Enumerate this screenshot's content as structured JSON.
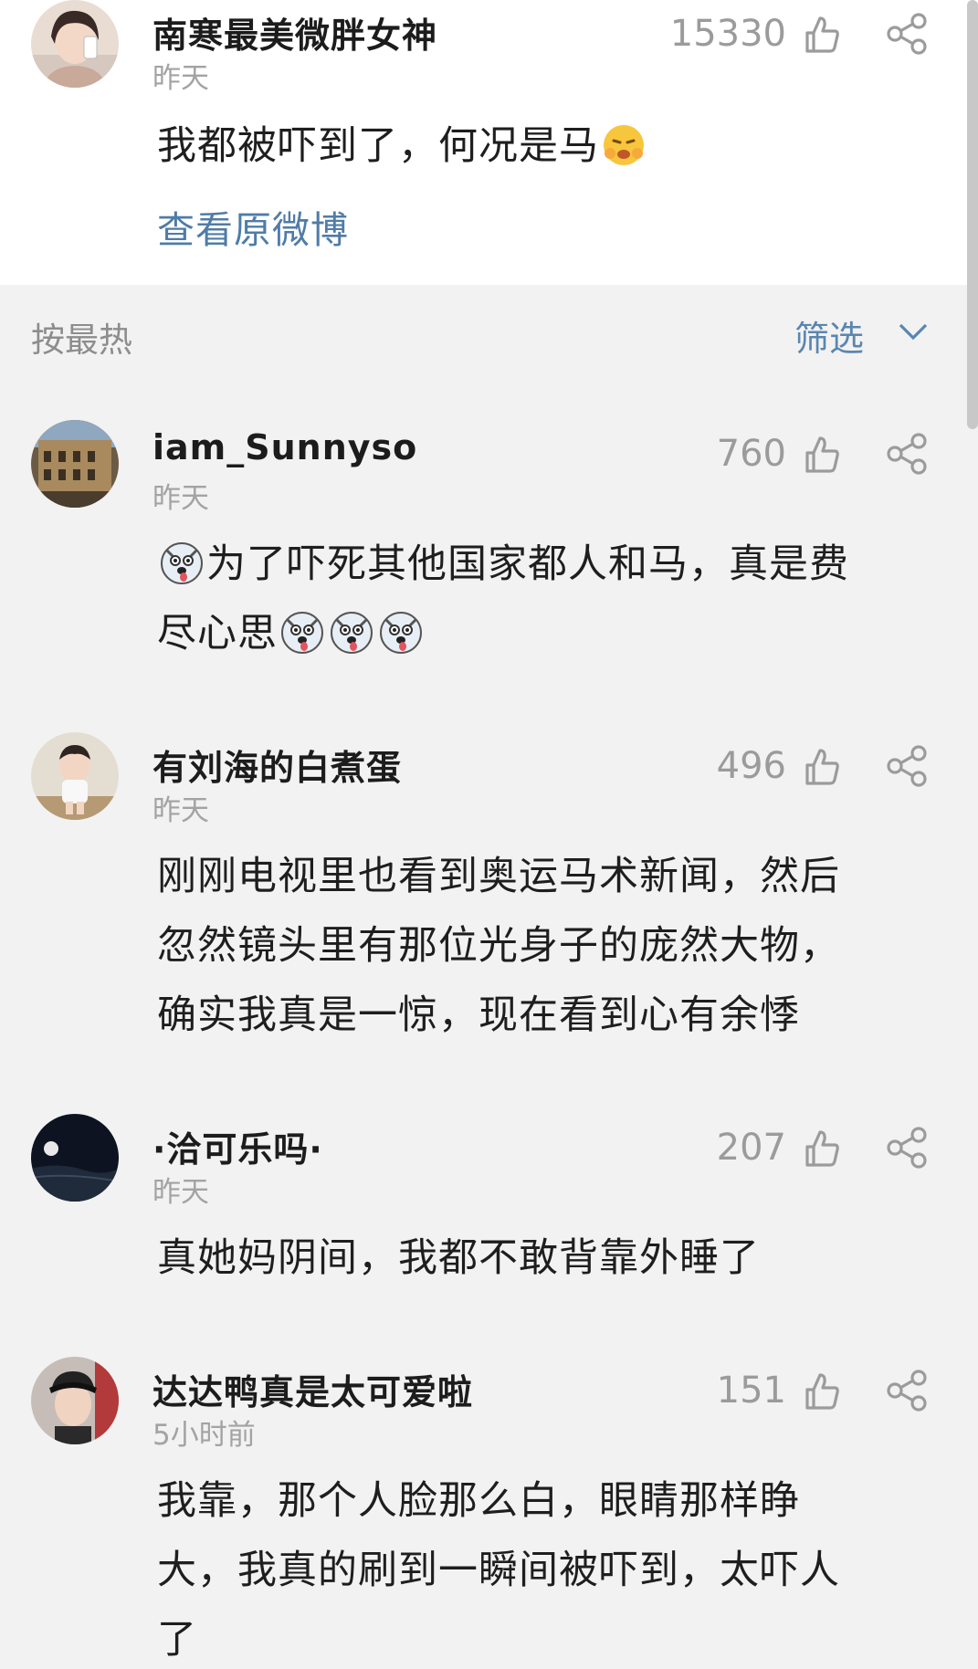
{
  "top_comment": {
    "username": "南寒最美微胖女神",
    "time": "昨天",
    "likes": "15330",
    "text": "我都被吓到了，何况是马",
    "emoji": "smirk-emoji",
    "view_original": "查看原微博"
  },
  "sort_bar": {
    "label": "按最热",
    "filter": "筛选"
  },
  "comments": [
    {
      "username": "iam_Sunnyso",
      "time": "昨天",
      "likes": "760",
      "line1": "为了吓死其他国家都人和马，真是费",
      "line2": "尽心思"
    },
    {
      "username": "有刘海的白煮蛋",
      "time": "昨天",
      "likes": "496",
      "line1": "刚刚电视里也看到奥运马术新闻，然后",
      "line2": "忽然镜头里有那位光身子的庞然大物，",
      "line3": "确实我真是一惊，现在看到心有余悸"
    },
    {
      "username": "·洽可乐吗·",
      "time": "昨天",
      "likes": "207",
      "line1": "真她妈阴间，我都不敢背靠外睡了"
    },
    {
      "username": "达达鸭真是太可爱啦",
      "time": "5小时前",
      "likes": "151",
      "line1": "我靠，那个人脸那么白，眼睛那样睁",
      "line2": "大，我真的刷到一瞬间被吓到，太吓人",
      "line3": "了"
    }
  ],
  "colors": {
    "background": "#f2f2f2",
    "card": "#ffffff",
    "link": "#4f7ca8",
    "muted": "#9b9b9b"
  }
}
